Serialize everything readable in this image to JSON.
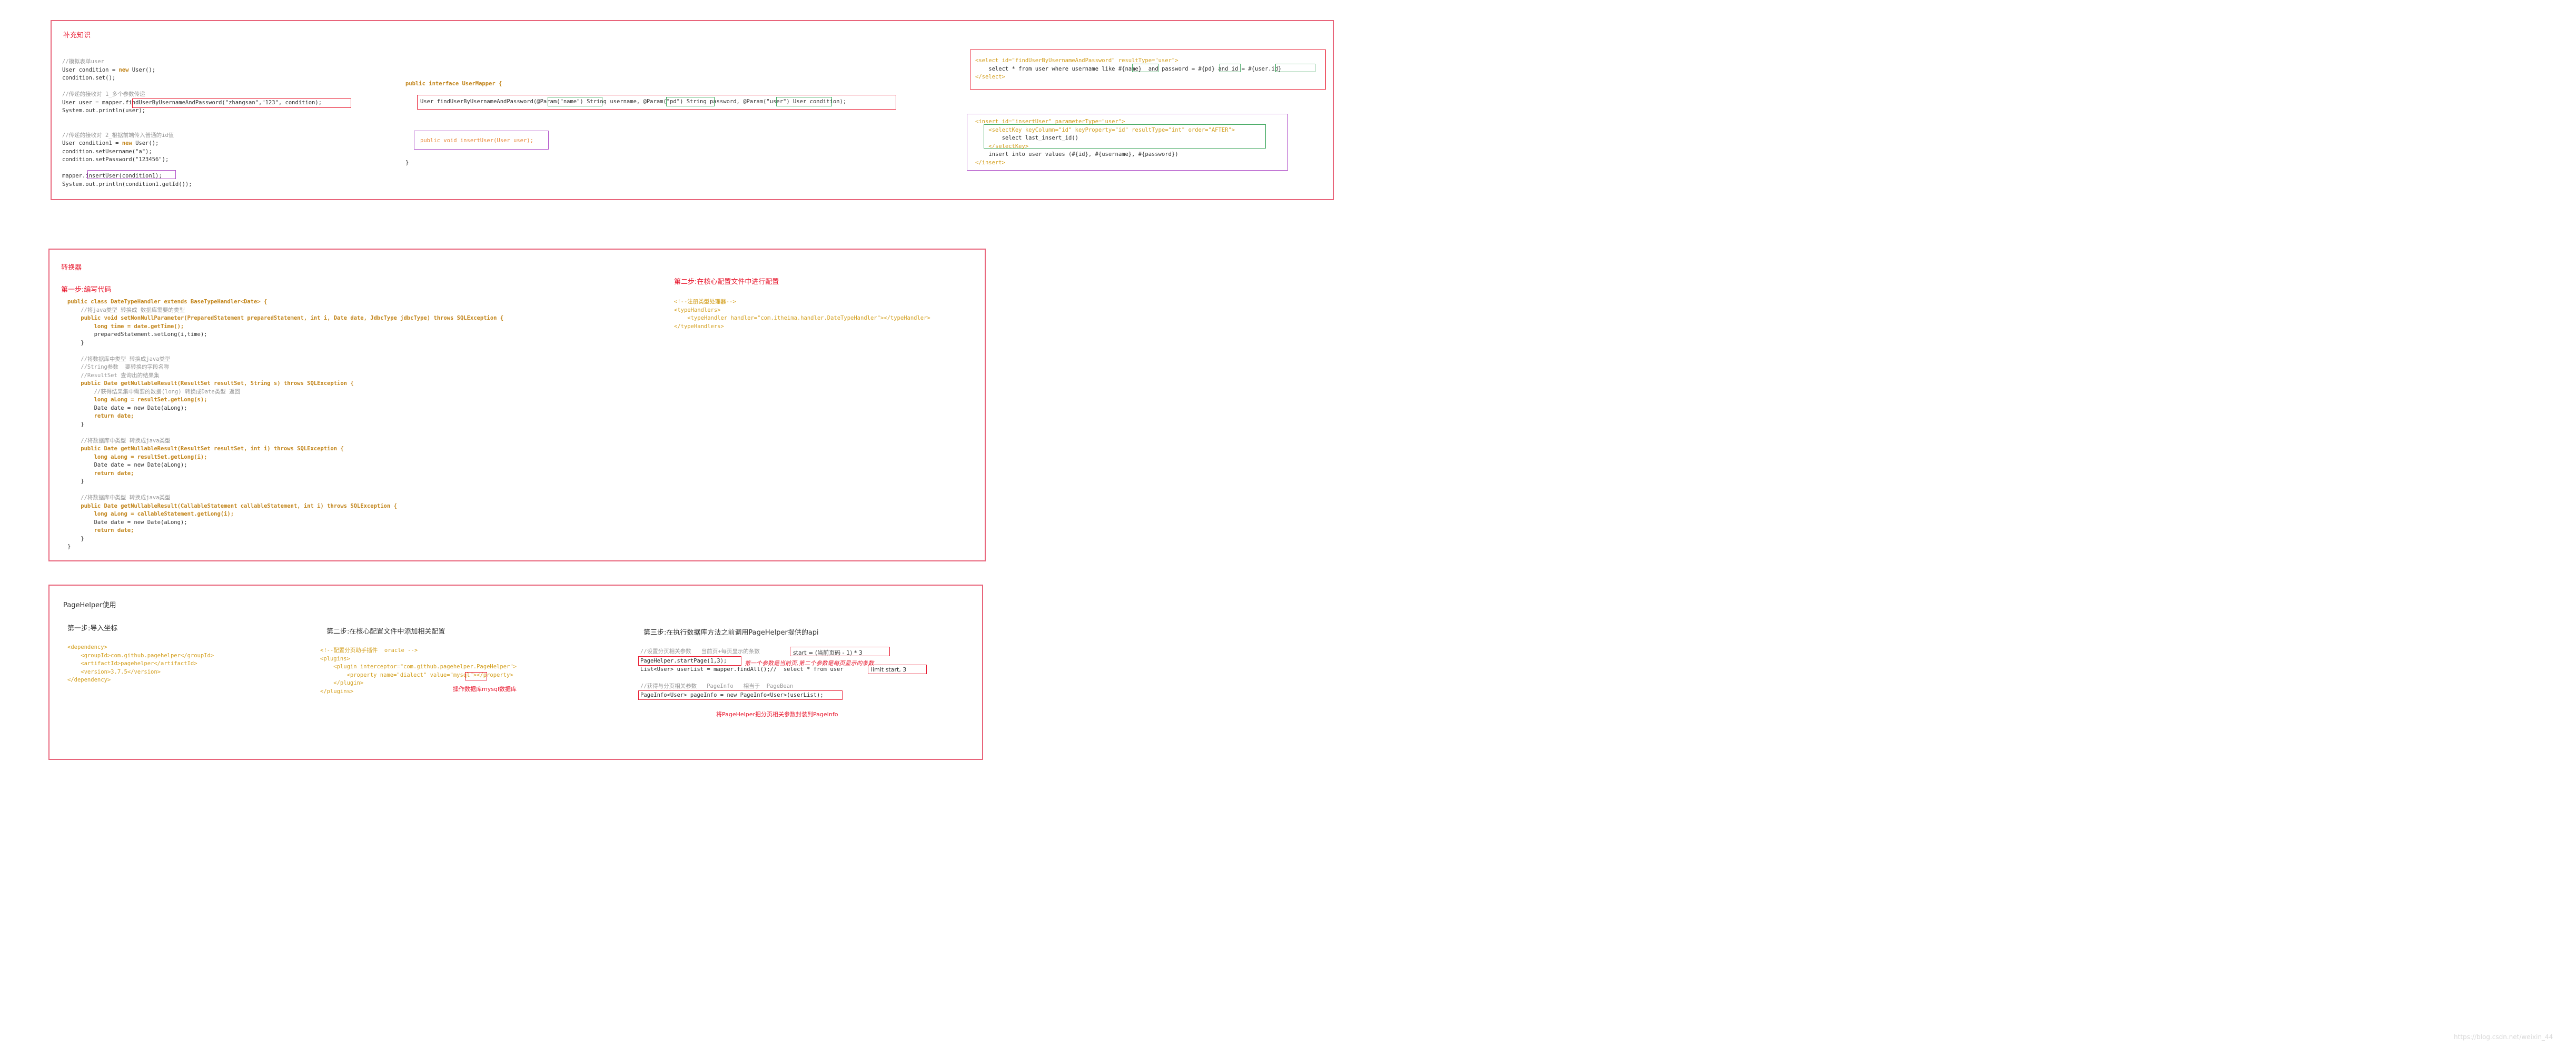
{
  "section1": {
    "title": "补充知识",
    "col1": [
      [
        "c",
        "//模拟表单user"
      ],
      [
        "t",
        "User condition = ",
        "k",
        "new ",
        "t",
        "User();"
      ],
      [
        "t",
        "condition.set();"
      ],
      [
        "t",
        ""
      ],
      [
        "c",
        "//传递的接收对 1_多个参数传递"
      ],
      [
        "t",
        "User user = mapper.findUserByUsernameAndPassword(\"zhangsan\",\"123\", condition);"
      ],
      [
        "t",
        "System.out.println(user);"
      ],
      [
        "t",
        ""
      ],
      [
        "t",
        ""
      ],
      [
        "c",
        "//传递的接收对 2_根据前端传入普通的id值"
      ],
      [
        "t",
        "User condition1 = ",
        "k",
        "new ",
        "t",
        "User();"
      ],
      [
        "t",
        "condition.setUsername(\"a\");"
      ],
      [
        "t",
        "condition.setPassword(\"123456\");"
      ],
      [
        "t",
        ""
      ],
      [
        "t",
        "mapper.insertUser(condition1);"
      ],
      [
        "t",
        "System.out.println(condition1.getId());"
      ]
    ],
    "interface_line1": "public interface UserMapper {",
    "method1": "User findUserByUsernameAndPassword(@Param(\"name\") String username, @Param(\"pd\") String password, @Param(\"user\") User condition);",
    "method2": "public void insertUser(User user);",
    "interface_close": "}",
    "sql_select": [
      "<select id=\"findUserByUsernameAndPassword\" resultType=\"user\">",
      "    select * from user where username like #{name}  and password = #{pd} and id = #{user.id}",
      "</select>"
    ],
    "sql_insert": [
      "<insert id=\"insertUser\" parameterType=\"user\">",
      "    <selectKey keyColumn=\"id\" keyProperty=\"id\" resultType=\"int\" order=\"AFTER\">",
      "        select last_insert_id()",
      "    </selectKey>",
      "    insert into user values (#{id}, #{username}, #{password})",
      "</insert>"
    ]
  },
  "section2": {
    "title": "转换器",
    "step1_title": "第一步:编写代码",
    "code": [
      "public class DateTypeHandler extends BaseTypeHandler<Date> {",
      "    //将java类型 转换成 数据库需要的类型",
      "    public void setNonNullParameter(PreparedStatement preparedStatement, int i, Date date, JdbcType jdbcType) throws SQLException {",
      "        long time = date.getTime();",
      "        preparedStatement.setLong(i,time);",
      "    }",
      "",
      "    //将数据库中类型 转换成java类型",
      "    //String参数  要转换的字段名称",
      "    //ResultSet 查询出的结果集",
      "    public Date getNullableResult(ResultSet resultSet, String s) throws SQLException {",
      "        //获得结果集中需要的数据(long) 转换成Date类型 返回",
      "        long aLong = resultSet.getLong(s);",
      "        Date date = new Date(aLong);",
      "        return date;",
      "    }",
      "",
      "    //将数据库中类型 转换成java类型",
      "    public Date getNullableResult(ResultSet resultSet, int i) throws SQLException {",
      "        long aLong = resultSet.getLong(i);",
      "        Date date = new Date(aLong);",
      "        return date;",
      "    }",
      "",
      "    //将数据库中类型 转换成java类型",
      "    public Date getNullableResult(CallableStatement callableStatement, int i) throws SQLException {",
      "        long aLong = callableStatement.getLong(i);",
      "        Date date = new Date(aLong);",
      "        return date;",
      "    }",
      "}"
    ],
    "step2_title": "第二步:在核心配置文件中进行配置",
    "config": [
      "<!--注册类型处理器-->",
      "<typeHandlers>",
      "    <typeHandler handler=\"com.itheima.handler.DateTypeHandler\"></typeHandler>",
      "</typeHandlers>"
    ]
  },
  "section3": {
    "title": "PageHelper使用",
    "step1_title": "第一步:导入坐标",
    "step1_code": [
      "<dependency>",
      "    <groupId>com.github.pagehelper</groupId>",
      "    <artifactId>pagehelper</artifactId>",
      "    <version>3.7.5</version>",
      "</dependency>"
    ],
    "step2_title": "第二步:在核心配置文件中添加相关配置",
    "step2_code": [
      "<!--配置分页助手插件  oracle -->",
      "<plugins>",
      "    <plugin interceptor=\"com.github.pagehelper.PageHelper\">",
      "        <property name=\"dialect\" value=\"mysql\"></property>",
      "    </plugin>",
      "</plugins>"
    ],
    "step2_note": "操作数据库mysql数据库",
    "step3_title": "第三步:在执行数据库方法之前调用PageHelper提供的api",
    "step3_comment": "//设置分页相关参数   当前页+每页显示的条数",
    "step3_formula": "start = (当前页码 - 1) * 3",
    "step3_call": "PageHelper.startPage(1,3);",
    "step3_call_note": "第一个参数是当前页,第二个参数是每页显示的条数",
    "step3_query": "List<User> userList = mapper.findAll();//  select * from user",
    "step3_limit": "limit start, 3",
    "step3_comment2": "//获得与分页相关参数   PageInfo   相当于  PageBean",
    "step3_pageinfo": "PageInfo<User> pageInfo = new PageInfo<User>(userList);",
    "step3_note": "将PageHelper把分页相关参数封装到PageInfo"
  },
  "watermark": "https://blog.csdn.net/weixin_44"
}
